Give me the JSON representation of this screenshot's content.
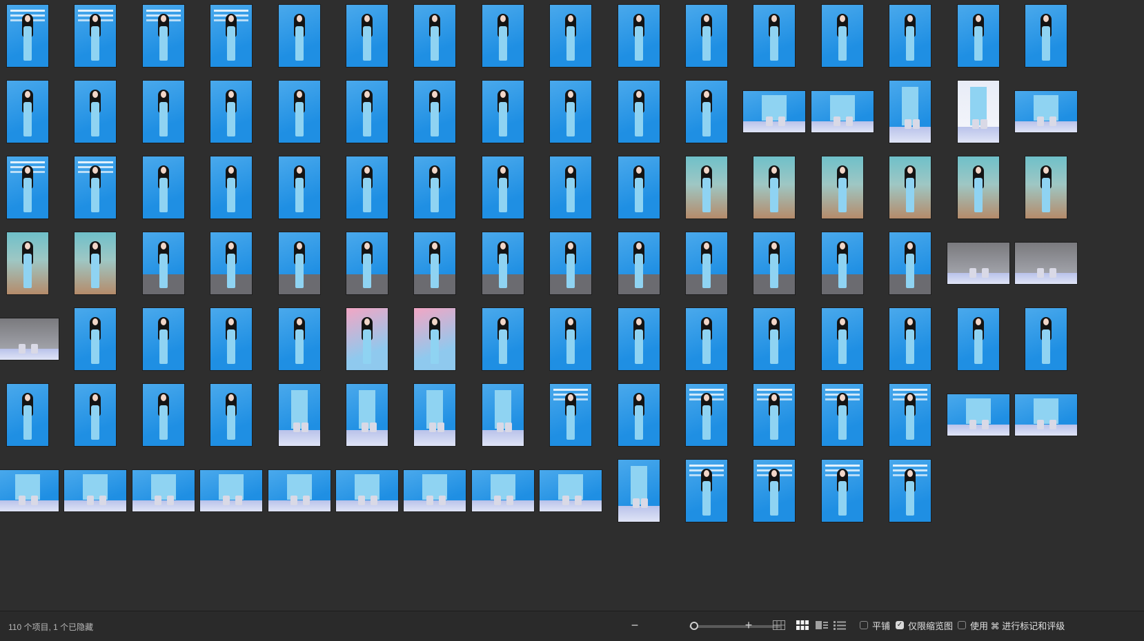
{
  "app": {
    "status_text": "110 个项目, 1 个已隐藏",
    "zoom_out_label": "−",
    "zoom_in_label": "+",
    "zoom_level": 0.02,
    "view_modes": [
      {
        "name": "grid-view-icon",
        "active": false
      },
      {
        "name": "thumbnail-view-icon",
        "active": true
      },
      {
        "name": "filmstrip-view-icon",
        "active": false
      },
      {
        "name": "list-view-icon",
        "active": false
      }
    ],
    "options": [
      {
        "label": "平铺",
        "checked": false
      },
      {
        "label": "仅限缩览图",
        "checked": true
      },
      {
        "label": "使用 ⌘ 进行标记和评级",
        "checked": false
      }
    ]
  },
  "colors": {
    "background": "#2e2e2e",
    "stage_blue": "#1f8fe3",
    "stage_light": "#4aa9ec",
    "dress": "#8fd3f2",
    "floor": "#c7cdee"
  },
  "thumbnails": [
    [
      "p:stage-text",
      "p:stage-text",
      "p:stage-text",
      "p:stage-text",
      "p:stage",
      "p:stage",
      "p:stage",
      "p:stage",
      "p:stage",
      "p:stage",
      "p:stage",
      "p:stage",
      "p:stage",
      "p:stage",
      "p:stage",
      "p:stage"
    ],
    [
      "p:stage",
      "p:stage",
      "p:stage",
      "p:stage",
      "p:stage",
      "p:stage",
      "p:stage",
      "p:stage",
      "p:stage",
      "p:stage",
      "p:stage",
      "l:legs",
      "l:legs",
      "p:legs",
      "p:legs-white",
      "l:legs"
    ],
    [
      "p:stage-text",
      "p:stage-text",
      "p:stage",
      "p:stage",
      "p:stage",
      "p:stage",
      "p:stage",
      "p:stage",
      "p:stage",
      "p:stage",
      "p:poster",
      "p:poster",
      "p:poster",
      "p:poster",
      "p:poster",
      "p:poster"
    ],
    [
      "p:poster",
      "p:poster",
      "p:seated",
      "p:seated",
      "p:seated",
      "p:seated",
      "p:seated",
      "p:seated",
      "p:seated",
      "p:seated",
      "p:seated",
      "p:seated",
      "p:seated",
      "p:seated",
      "l:legs-dark",
      "l:legs-dark"
    ],
    [
      "l:legs-dark",
      "p:stage",
      "p:stage",
      "p:stage",
      "p:stage",
      "p:pink",
      "p:pink",
      "p:stage",
      "p:stage",
      "p:stage",
      "p:stage",
      "p:stage",
      "p:stage",
      "p:stage",
      "p:stage",
      "p:stage"
    ],
    [
      "p:stage",
      "p:stage",
      "p:stage",
      "p:stage",
      "p:legs",
      "p:legs",
      "p:legs",
      "p:legs",
      "p:stage-text",
      "p:stage",
      "p:stage-text",
      "p:stage-text",
      "p:stage-text",
      "p:stage-text",
      "l:legs",
      "l:legs"
    ],
    [
      "l:legs",
      "l:legs",
      "l:legs",
      "l:legs",
      "l:legs",
      "l:legs",
      "l:legs",
      "l:legs",
      "l:legs",
      "p:legs",
      "p:stage-text",
      "p:stage-text",
      "p:stage-text",
      "p:stage-text"
    ]
  ]
}
